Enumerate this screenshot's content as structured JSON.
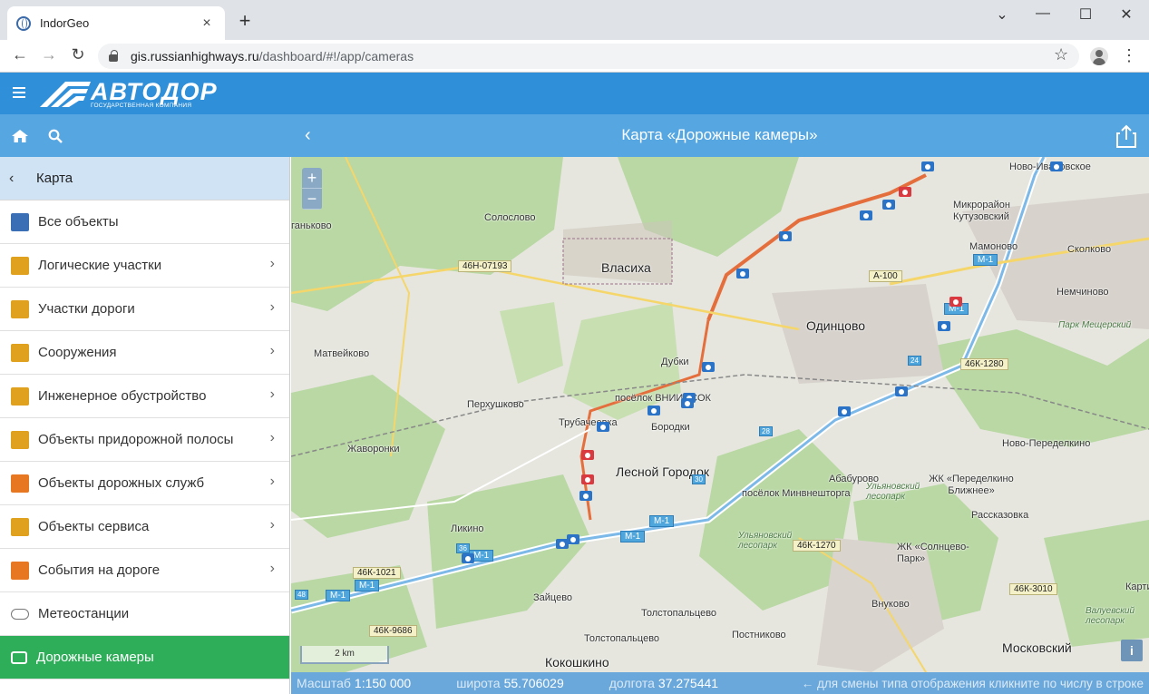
{
  "browser": {
    "tab_title": "IndorGeo",
    "tab_close": "×",
    "new_tab": "+",
    "url_host": "gis.russianhighways.ru",
    "url_path": "/dashboard/#!/app/cameras",
    "back": "←",
    "forward": "→",
    "reload": "↻",
    "bookmark": "☆",
    "menu": "⋮",
    "minimize": "—",
    "maximize": "☐",
    "close": "✕",
    "tab_strip": "⌄"
  },
  "header": {
    "logo_text": "АВТОДОР",
    "logo_subtitle": "ГОСУДАРСТВЕННАЯ КОМПАНИЯ"
  },
  "toolbar": {
    "back": "‹",
    "page_title": "Карта «Дорожные камеры»"
  },
  "sidebar": {
    "header_label": "Карта",
    "header_chevron": "‹",
    "items": [
      {
        "label": "Все объекты",
        "icon": "map-icon",
        "color": "#3a6fb5",
        "arrow": ""
      },
      {
        "label": "Логические участки",
        "icon": "logical-section-icon",
        "color": "#e0a21e",
        "arrow": "›"
      },
      {
        "label": "Участки дороги",
        "icon": "road-section-icon",
        "color": "#e0a21e",
        "arrow": "›"
      },
      {
        "label": "Сооружения",
        "icon": "bridge-icon",
        "color": "#e0a21e",
        "arrow": "›"
      },
      {
        "label": "Инженерное обустройство",
        "icon": "speed-sign-icon",
        "color": "#e0a21e",
        "arrow": "›"
      },
      {
        "label": "Объекты придорожной полосы",
        "icon": "tree-icon",
        "color": "#e0a21e",
        "arrow": "›"
      },
      {
        "label": "Объекты дорожных служб",
        "icon": "road-service-icon",
        "color": "#e87722",
        "arrow": "›"
      },
      {
        "label": "Объекты сервиса",
        "icon": "fuel-station-icon",
        "color": "#e0a21e",
        "arrow": "›"
      },
      {
        "label": "События на дороге",
        "icon": "road-works-icon",
        "color": "#e87722",
        "arrow": "›"
      },
      {
        "label": "Метеостанции",
        "icon": "weather-icon",
        "color": "#888888",
        "arrow": ""
      },
      {
        "label": "Дорожные камеры",
        "icon": "camera-icon",
        "color": "#ffffff",
        "arrow": ""
      }
    ]
  },
  "map": {
    "zoom_in": "+",
    "zoom_out": "−",
    "scale_bar": "2 km",
    "info": "i",
    "labels": [
      {
        "text": "Ново-Ивановское",
        "kind": "place"
      },
      {
        "text": "Солослово",
        "kind": "place"
      },
      {
        "text": "Микрорайон Кутузовский",
        "kind": "place"
      },
      {
        "text": "ганьково",
        "kind": "place"
      },
      {
        "text": "Мамоново",
        "kind": "place"
      },
      {
        "text": "Сколково",
        "kind": "place"
      },
      {
        "text": "Власиха",
        "kind": "city"
      },
      {
        "text": "Немчиново",
        "kind": "place"
      },
      {
        "text": "Парк Мещерский",
        "kind": "park"
      },
      {
        "text": "Одинцово",
        "kind": "city"
      },
      {
        "text": "Матвейково",
        "kind": "place"
      },
      {
        "text": "Дубки",
        "kind": "place"
      },
      {
        "text": "Перхушково",
        "kind": "place"
      },
      {
        "text": "посёлок ВНИИССОК",
        "kind": "place"
      },
      {
        "text": "Трубачеевка",
        "kind": "place"
      },
      {
        "text": "Бородки",
        "kind": "place"
      },
      {
        "text": "Ново-Переделкино",
        "kind": "place"
      },
      {
        "text": "Жаворонки",
        "kind": "place"
      },
      {
        "text": "Лесной Городок",
        "kind": "city"
      },
      {
        "text": "Абабурово",
        "kind": "place"
      },
      {
        "text": "ЖК «Переделкино Ближнее»",
        "kind": "place"
      },
      {
        "text": "посёлок Минвнешторга",
        "kind": "place"
      },
      {
        "text": "Ульяновский лесопарк",
        "kind": "park"
      },
      {
        "text": "Рассказовка",
        "kind": "place"
      },
      {
        "text": "Ликино",
        "kind": "place"
      },
      {
        "text": "ЖК «Солнцево-Парк»",
        "kind": "place"
      },
      {
        "text": "Ульяновский лесопарк",
        "kind": "park"
      },
      {
        "text": "Зайцево",
        "kind": "place"
      },
      {
        "text": "Внуково",
        "kind": "place"
      },
      {
        "text": "Толстопальцево",
        "kind": "place"
      },
      {
        "text": "Постниково",
        "kind": "place"
      },
      {
        "text": "Валуевский лесопарк",
        "kind": "park"
      },
      {
        "text": "Толстопальцево",
        "kind": "place"
      },
      {
        "text": "Кокошкино",
        "kind": "city"
      },
      {
        "text": "Московский",
        "kind": "city"
      },
      {
        "text": "Карти",
        "kind": "place"
      }
    ],
    "road_badges": [
      "46Н-07193",
      "А-100",
      "46К-1280",
      "46К-1270",
      "46К-3010",
      "46К-1021",
      "46К-9686"
    ],
    "m1_badges": [
      "М-1",
      "М-1",
      "М-1",
      "М-1",
      "М-1",
      "М-1",
      "М-1"
    ],
    "shield_numbers": [
      "24",
      "28",
      "30",
      "36",
      "48"
    ]
  },
  "status": {
    "scale_label": "Масштаб",
    "scale_value": "1:150 000",
    "lat_label": "широта",
    "lat_value": "55.706029",
    "lon_label": "долгота",
    "lon_value": "37.275441",
    "hint": "← для смены типа отображения кликните по числу в строке"
  }
}
